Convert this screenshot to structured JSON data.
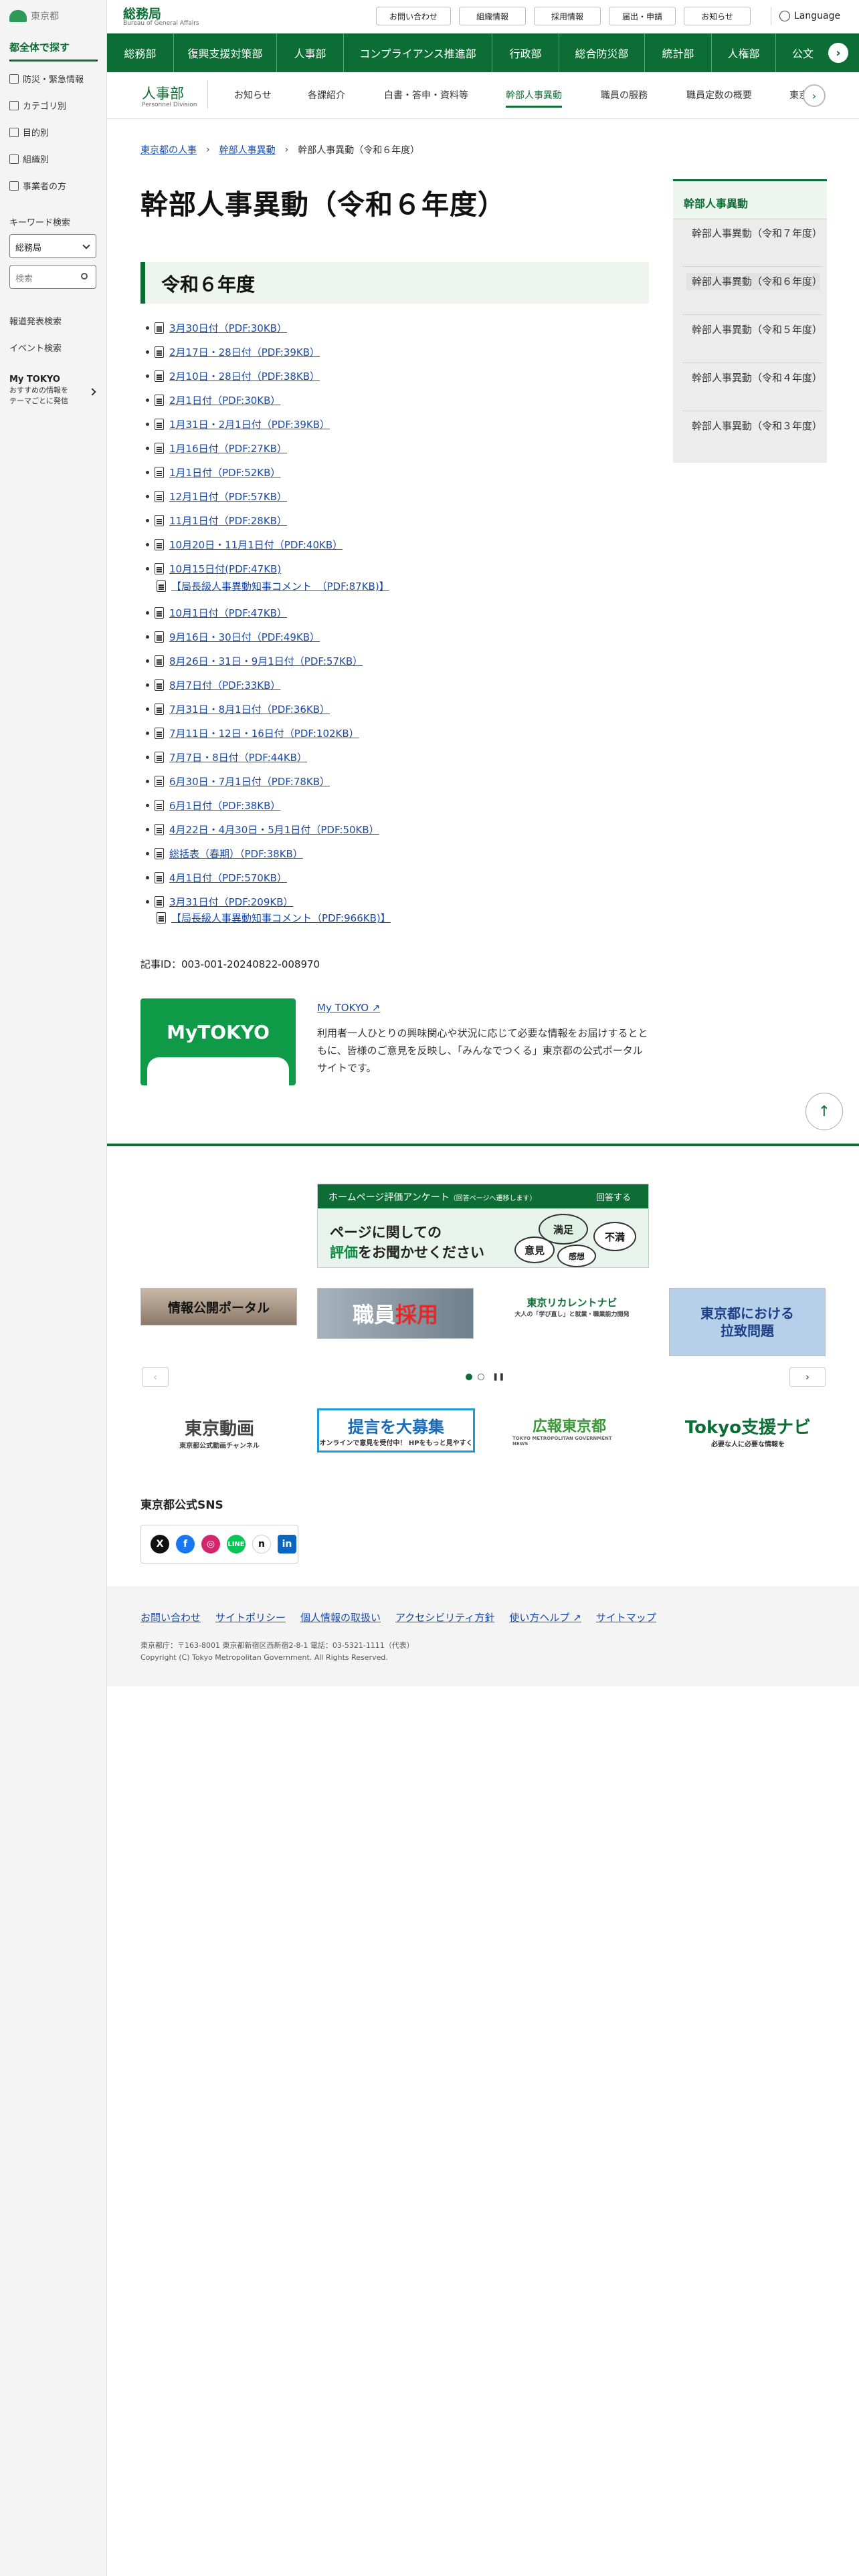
{
  "sidebar": {
    "logo_text": "東京都",
    "title": "都全体で探す",
    "links": [
      "防災・緊急情報",
      "カテゴリ別",
      "目的別",
      "組織別",
      "事業者の方"
    ],
    "keyword_label": "キーワード検索",
    "select_value": "総務局",
    "search_placeholder": "検索",
    "press_search": "報道発表検索",
    "event_search": "イベント検索",
    "mytokyo_title": "My TOKYO",
    "mytokyo_desc_1": "おすすめの情報を",
    "mytokyo_desc_2": "テーマごとに発信"
  },
  "header": {
    "bureau": "総務局",
    "bureau_en": "Bureau of General Affairs",
    "utility": [
      "お問い合わせ",
      "組織情報",
      "採用情報",
      "届出・申請",
      "お知らせ"
    ],
    "language": "Language",
    "gnav": [
      "総務部",
      "復興支援対策部",
      "人事部",
      "コンプライアンス推進部",
      "行政部",
      "総合防災部",
      "統計部",
      "人権部",
      "公文"
    ]
  },
  "subnav": {
    "title": "人事部",
    "title_en": "Personnel Division",
    "items": [
      "お知らせ",
      "各課紹介",
      "白書・答申・資料等",
      "幹部人事異動",
      "職員の服務",
      "職員定数の概要",
      "東京"
    ]
  },
  "breadcrumb": [
    "東京都の人事",
    "幹部人事異動",
    "幹部人事異動（令和６年度）"
  ],
  "page_title": "幹部人事異動（令和６年度）",
  "section_heading": "令和６年度",
  "list": [
    "3月30日付（PDF:30KB）",
    "2月17日・28日付（PDF:39KB）",
    "2月10日・28日付（PDF:38KB）",
    "2月1日付（PDF:30KB）",
    "1月31日・2月1日付（PDF:39KB）",
    "1月16日付（PDF:27KB）",
    "1月1日付（PDF:52KB）",
    "12月1日付（PDF:57KB）",
    "11月1日付（PDF:28KB）",
    "10月20日・11月1日付（PDF:40KB）",
    "10月15日付(PDF:47KB)",
    "10月1日付（PDF:47KB）",
    "9月16日・30日付（PDF:49KB）",
    "8月26日・31日・9月1日付（PDF:57KB）",
    "8月7日付（PDF:33KB）",
    "7月31日・8月1日付（PDF:36KB）",
    "7月11日・12日・16日付（PDF:102KB）",
    "7月7日・8日付（PDF:44KB）",
    "6月30日・7月1日付（PDF:78KB）",
    "6月1日付（PDF:38KB）",
    "4月22日・4月30日・5月1日付（PDF:50KB）",
    "総括表（春期）（PDF:38KB）",
    "4月1日付（PDF:570KB）",
    "3月31日付（PDF:209KB）"
  ],
  "sub_comments": {
    "c1": "【局長級人事異動知事コメント　（PDF:87KB)】",
    "c2": "【局長級人事異動知事コメント（PDF:966KB)】"
  },
  "record_id": "記事ID：003-001-20240822-008970",
  "mytokyo": {
    "logo": "MyTOKYO",
    "link": "My TOKYO",
    "text": "利用者一人ひとりの興味関心や状況に応じて必要な情報をお届けするとともに、皆様のご意見を反映し、「みんなでつくる」東京都の公式ポータルサイトです。"
  },
  "survey": {
    "bar": "ホームページ評価アンケート",
    "bar_small": "（回答ページへ遷移します）",
    "answer": "回答する",
    "line1": "ページに関しての",
    "line2a": "評価",
    "line2b": "をお聞かせください",
    "b1": "満足",
    "b2": "不満",
    "b3": "意見",
    "b4": "感想"
  },
  "banners": {
    "b1": "情報公開ポータル",
    "b2a": "職員",
    "b2b": "採用",
    "b3": "東京リカレントナビ",
    "b3s": "大人の「学び直し」と就業・職業能力開発",
    "b4a": "東京都における",
    "b4b": "拉致問題",
    "c1": "東京動画",
    "c1s": "東京都公式動画チャンネル",
    "c2": "提言を大募集",
    "c2s": "オンラインで意見を受付中！ HPをもっと見やすく",
    "c3": "広報東京都",
    "c3s": "TOKYO METROPOLITAN GOVERNMENT NEWS",
    "c4": "Tokyo支援ナビ",
    "c4s": "必要な人に必要な情報を"
  },
  "sns_title": "東京都公式SNS",
  "footer": {
    "links": [
      "お問い合わせ",
      "サイトポリシー",
      "個人情報の取扱い",
      "アクセシビリティ方針",
      "使い方ヘルプ",
      "サイトマップ"
    ],
    "address": "東京都庁：〒163-8001 東京都新宿区西新宿2-8-1 電話：03-5321-1111（代表）",
    "copyright": "Copyright (C) Tokyo Metropolitan Government. All Rights Reserved."
  },
  "right_nav": {
    "title": "幹部人事異動",
    "items": [
      "幹部人事異動（令和７年度）",
      "幹部人事異動（令和６年度）",
      "幹部人事異動（令和５年度）",
      "幹部人事異動（令和４年度）",
      "幹部人事異動（令和３年度）"
    ]
  },
  "colors": {
    "brand_green": "#0d6e35",
    "link_blue": "#1a4aa8"
  }
}
